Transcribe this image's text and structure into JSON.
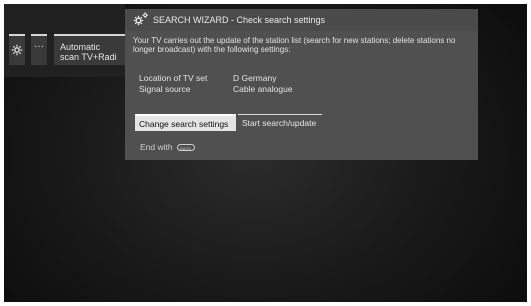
{
  "menu_strip": {
    "gear_label": "",
    "dots_label": "···",
    "scan_tile": {
      "line1": "Automatic",
      "line2": "scan TV+Radi"
    }
  },
  "dialog": {
    "title": "SEARCH WIZARD - Check search settings",
    "description": "Your TV carries out the update of the station list (search for new stations; delete stations no longer broadcast) with the following settings:",
    "settings": [
      {
        "label": "Location of TV set",
        "value": "D Germany"
      },
      {
        "label": "Signal source",
        "value": "Cable analogue"
      }
    ],
    "buttons": {
      "change": "Change search settings",
      "start": "Start search/update"
    },
    "footer": {
      "end_with": "End with",
      "key_label": "BACK"
    }
  },
  "colors": {
    "panel_bg": "#505050",
    "selected_button_bg": "#e4e4e4",
    "screen_bg": "#1a1a1a"
  }
}
